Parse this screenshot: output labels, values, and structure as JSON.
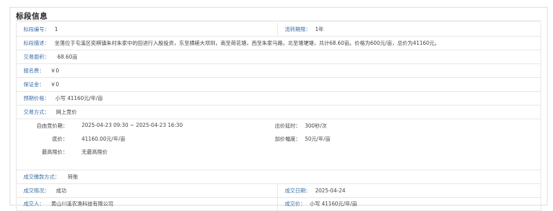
{
  "section_title": "标段信息",
  "row1": {
    "label": "标段编号：",
    "value": "1",
    "label2": "流转期限：",
    "value2": "1年"
  },
  "row2": {
    "label": "标段描述：",
    "value": "坐落位于屯溪区奕棋镇朱村朱家中的田进行入股投资，东至横槎大坝圳，南至荷花塘，西至朱家马路，北至塘埂塘，共计68.60亩。价格为600元/亩，总价为41160元。"
  },
  "row3": {
    "label": "交易面积：",
    "value": "68.60亩"
  },
  "row4": {
    "label": "报名费：",
    "value": "￥0"
  },
  "row5": {
    "label": "保证金：",
    "value": "￥0"
  },
  "row6": {
    "label": "预期价格：",
    "value": "小写 41160元/年/亩"
  },
  "row7": {
    "label": "交易方式：",
    "value": "网上竞价"
  },
  "auction": {
    "period_label": "自由竞价期：",
    "period_value": "2025-04-23 09:30 ~ 2025-04-23 16:30",
    "delay_label": "出价延时：",
    "delay_value": "300秒/次",
    "base_label": "底价：",
    "base_value": "41160.00元/年/亩",
    "increment_label": "加价幅度：",
    "increment_value": "50元/年/亩",
    "max_label": "最高限价：",
    "max_value": "无最高限价"
  },
  "row9": {
    "label": "成交缴款方式：",
    "value": "转账"
  },
  "row10": {
    "label": "成交情况：",
    "value": "成功",
    "label2": "成交日期：",
    "value2": "2025-04-24"
  },
  "row11": {
    "label": "成交人：",
    "value": "黄山川溪农渔科技有限公司",
    "label2": "成交价：",
    "value2": "小写 41160元/年/亩"
  }
}
